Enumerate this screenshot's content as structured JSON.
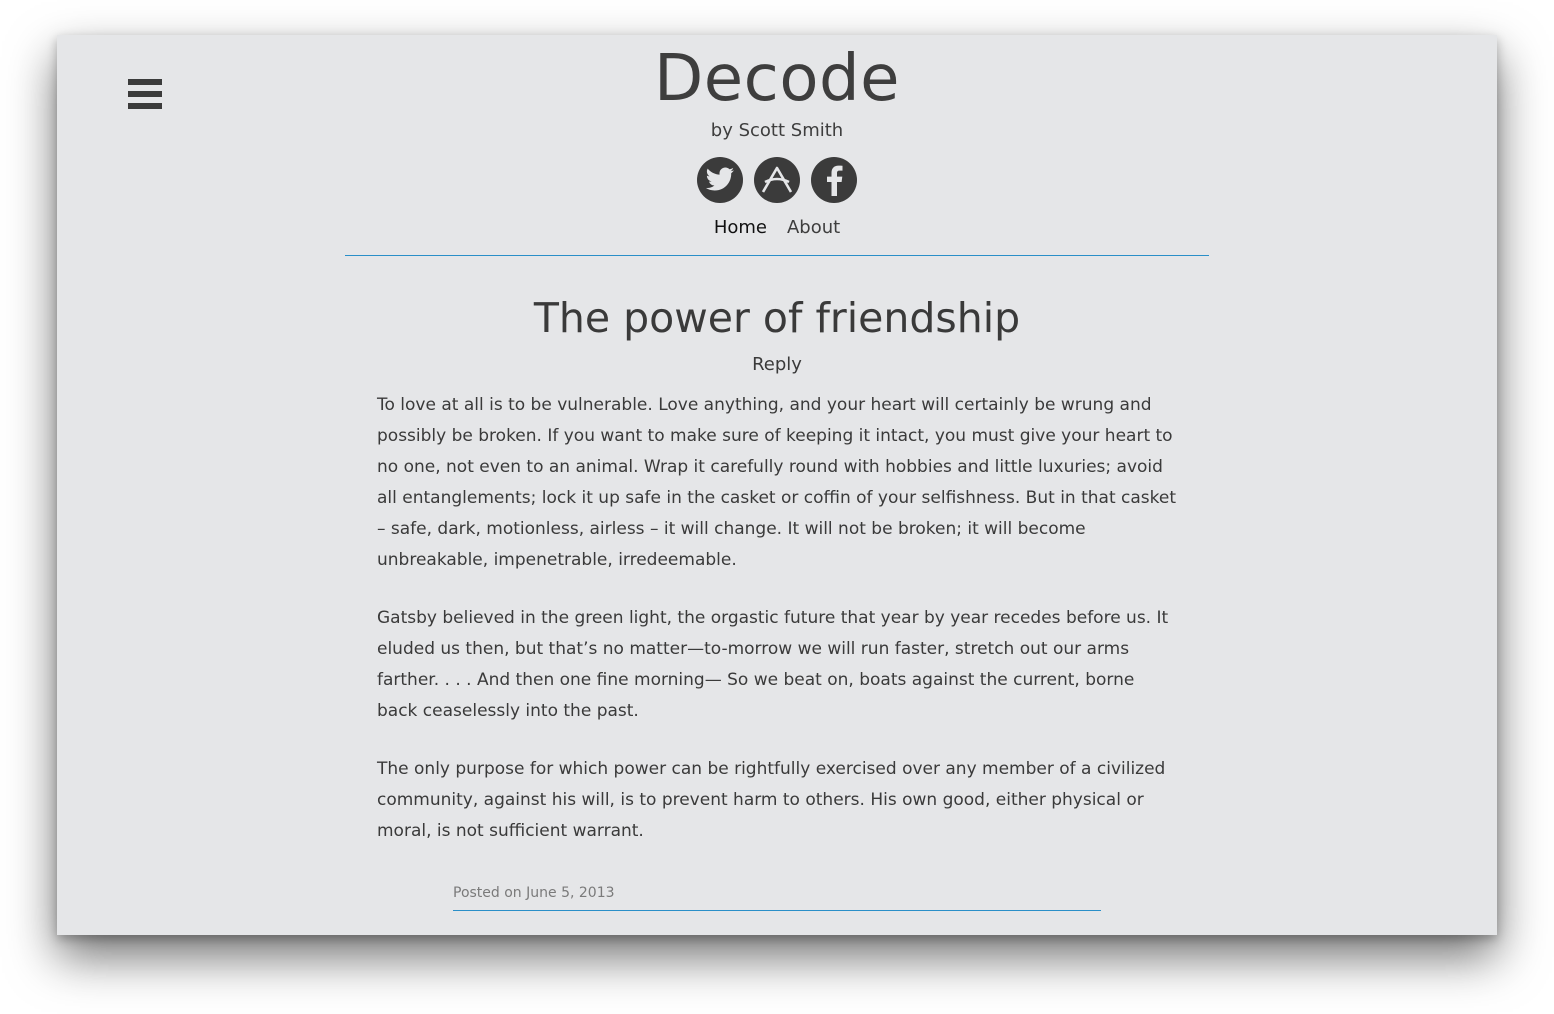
{
  "site": {
    "title": "Decode",
    "byline": "by Scott Smith",
    "menu_icon": "hamburger-menu-icon",
    "social": [
      {
        "icon": "twitter-icon"
      },
      {
        "icon": "app-net-icon"
      },
      {
        "icon": "facebook-icon"
      }
    ],
    "nav": [
      {
        "label": "Home",
        "current": true
      },
      {
        "label": "About",
        "current": false
      }
    ]
  },
  "post": {
    "title": "The power of friendship",
    "reply_label": "Reply",
    "paragraphs": [
      "To love at all is to be vulnerable. Love anything, and your heart will certainly be wrung and possibly be broken. If you want to make sure of keeping it intact, you must give your heart to no one, not even to an animal. Wrap it carefully round with hobbies and little luxuries; avoid all entanglements; lock it up safe in the casket or coffin of your selfishness. But in that casket – safe, dark, motionless, airless – it will change. It will not be broken; it will become unbreakable, impenetrable, irredeemable.",
      "Gatsby believed in the green light, the orgastic future that year by year recedes before us. It eluded us then, but that’s no matter—to-morrow we will run faster, stretch out our arms farther. . . . And then one fine morning— So we beat on, boats against the current, borne back ceaselessly into the past.",
      "The only purpose for which power can be rightfully exercised over any member of a civilized community, against his will, is to prevent harm to others. His own good, either physical or moral, is not sufficient warrant."
    ],
    "meta": "Posted on June 5, 2013"
  },
  "colors": {
    "background": "#e5e6e8",
    "text": "#3a3a3a",
    "accent_line": "#2a8fc8",
    "icon_fill": "#3b3b3b"
  }
}
